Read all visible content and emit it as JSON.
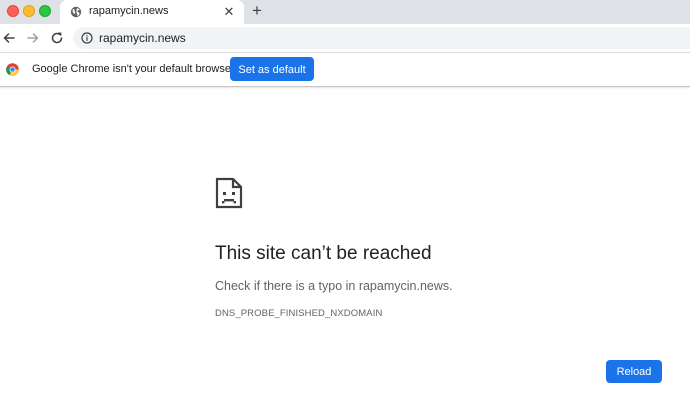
{
  "window": {
    "traffic_lights": [
      "close",
      "minimize",
      "zoom"
    ]
  },
  "tab": {
    "title": "rapamycin.news",
    "icon": "globe-icon",
    "close_glyph": "✕",
    "new_tab_glyph": "+"
  },
  "toolbar": {
    "icons": [
      "back-arrow-icon",
      "forward-arrow-icon",
      "reload-icon"
    ],
    "url": "rapamycin.news",
    "site_info_icon": "info-icon"
  },
  "infobar": {
    "message": "Google Chrome isn't your default browser",
    "button_label": "Set as default",
    "icon": "chrome-logo-icon"
  },
  "error": {
    "icon": "sad-page-icon",
    "title": "This site can’t be reached",
    "hint": "Check if there is a typo in rapamycin.news.",
    "code": "DNS_PROBE_FINISHED_NXDOMAIN",
    "reload_label": "Reload"
  },
  "colors": {
    "accent": "#1a73e8",
    "tabstrip": "#dee1e6",
    "omnibox": "#f1f3f4"
  }
}
